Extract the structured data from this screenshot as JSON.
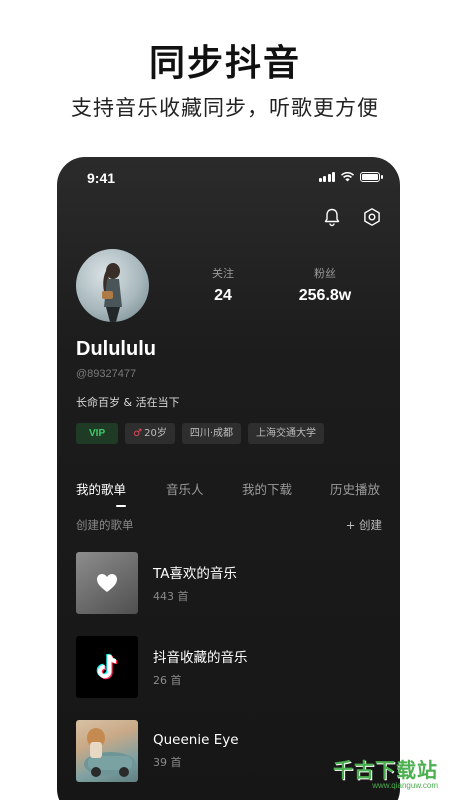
{
  "promo": {
    "title": "同步抖音",
    "subtitle": "支持音乐收藏同步，听歌更方便"
  },
  "status_bar": {
    "time": "9:41"
  },
  "header_icons": [
    "bell-icon",
    "settings-icon"
  ],
  "profile": {
    "stats": [
      {
        "label": "关注",
        "value": "24"
      },
      {
        "label": "粉丝",
        "value": "256.8w"
      }
    ],
    "username": "Dulululu",
    "user_id": "@89327477",
    "bio": "长命百岁 & 活在当下",
    "tags": {
      "vip": "VIP",
      "age_symbol": "♂",
      "age": "20岁",
      "location": "四川·成都",
      "school": "上海交通大学"
    }
  },
  "tabs": [
    "我的歌单",
    "音乐人",
    "我的下载",
    "历史播放"
  ],
  "section": {
    "title": "创建的歌单",
    "create_label": "+ 创建"
  },
  "playlists": [
    {
      "name": "TA喜欢的音乐",
      "count": "443 首",
      "cover_icon": "heart-icon"
    },
    {
      "name": "抖音收藏的音乐",
      "count": "26 首",
      "cover_icon": "tiktok-logo-icon"
    },
    {
      "name": "Queenie Eye",
      "count": "39 首",
      "cover_icon": "album-photo"
    }
  ],
  "watermark": {
    "text": "千古下载站",
    "url": "www.qianguw.com"
  },
  "colors": {
    "accent_vip": "#3ecb68",
    "phone_bg": "#1c1c1c",
    "watermark": "#4caf50"
  }
}
